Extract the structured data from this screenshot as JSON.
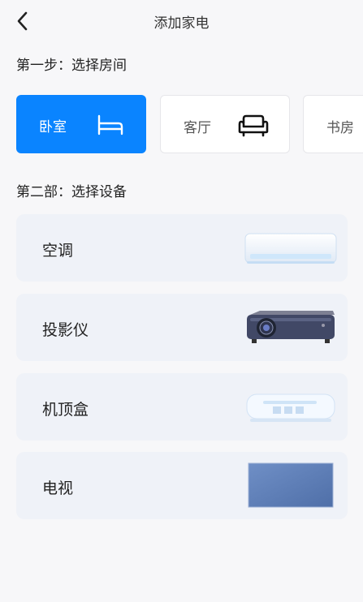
{
  "header": {
    "title": "添加家电",
    "back_icon": "chevron-left-icon"
  },
  "step1": {
    "label": "第一步：选择房间"
  },
  "rooms": [
    {
      "label": "卧室",
      "icon": "bed-icon",
      "selected": true
    },
    {
      "label": "客厅",
      "icon": "sofa-icon",
      "selected": false
    },
    {
      "label": "书房",
      "icon": "",
      "selected": false
    }
  ],
  "step2": {
    "label": "第二部：选择设备"
  },
  "devices": [
    {
      "label": "空调",
      "icon": "air-conditioner-image"
    },
    {
      "label": "投影仪",
      "icon": "projector-image"
    },
    {
      "label": "机顶盒",
      "icon": "set-top-box-image"
    },
    {
      "label": "电视",
      "icon": "tv-image"
    }
  ],
  "colors": {
    "accent": "#0a84ff",
    "card_bg": "#eff2f8",
    "page_bg": "#f7f7f9"
  }
}
